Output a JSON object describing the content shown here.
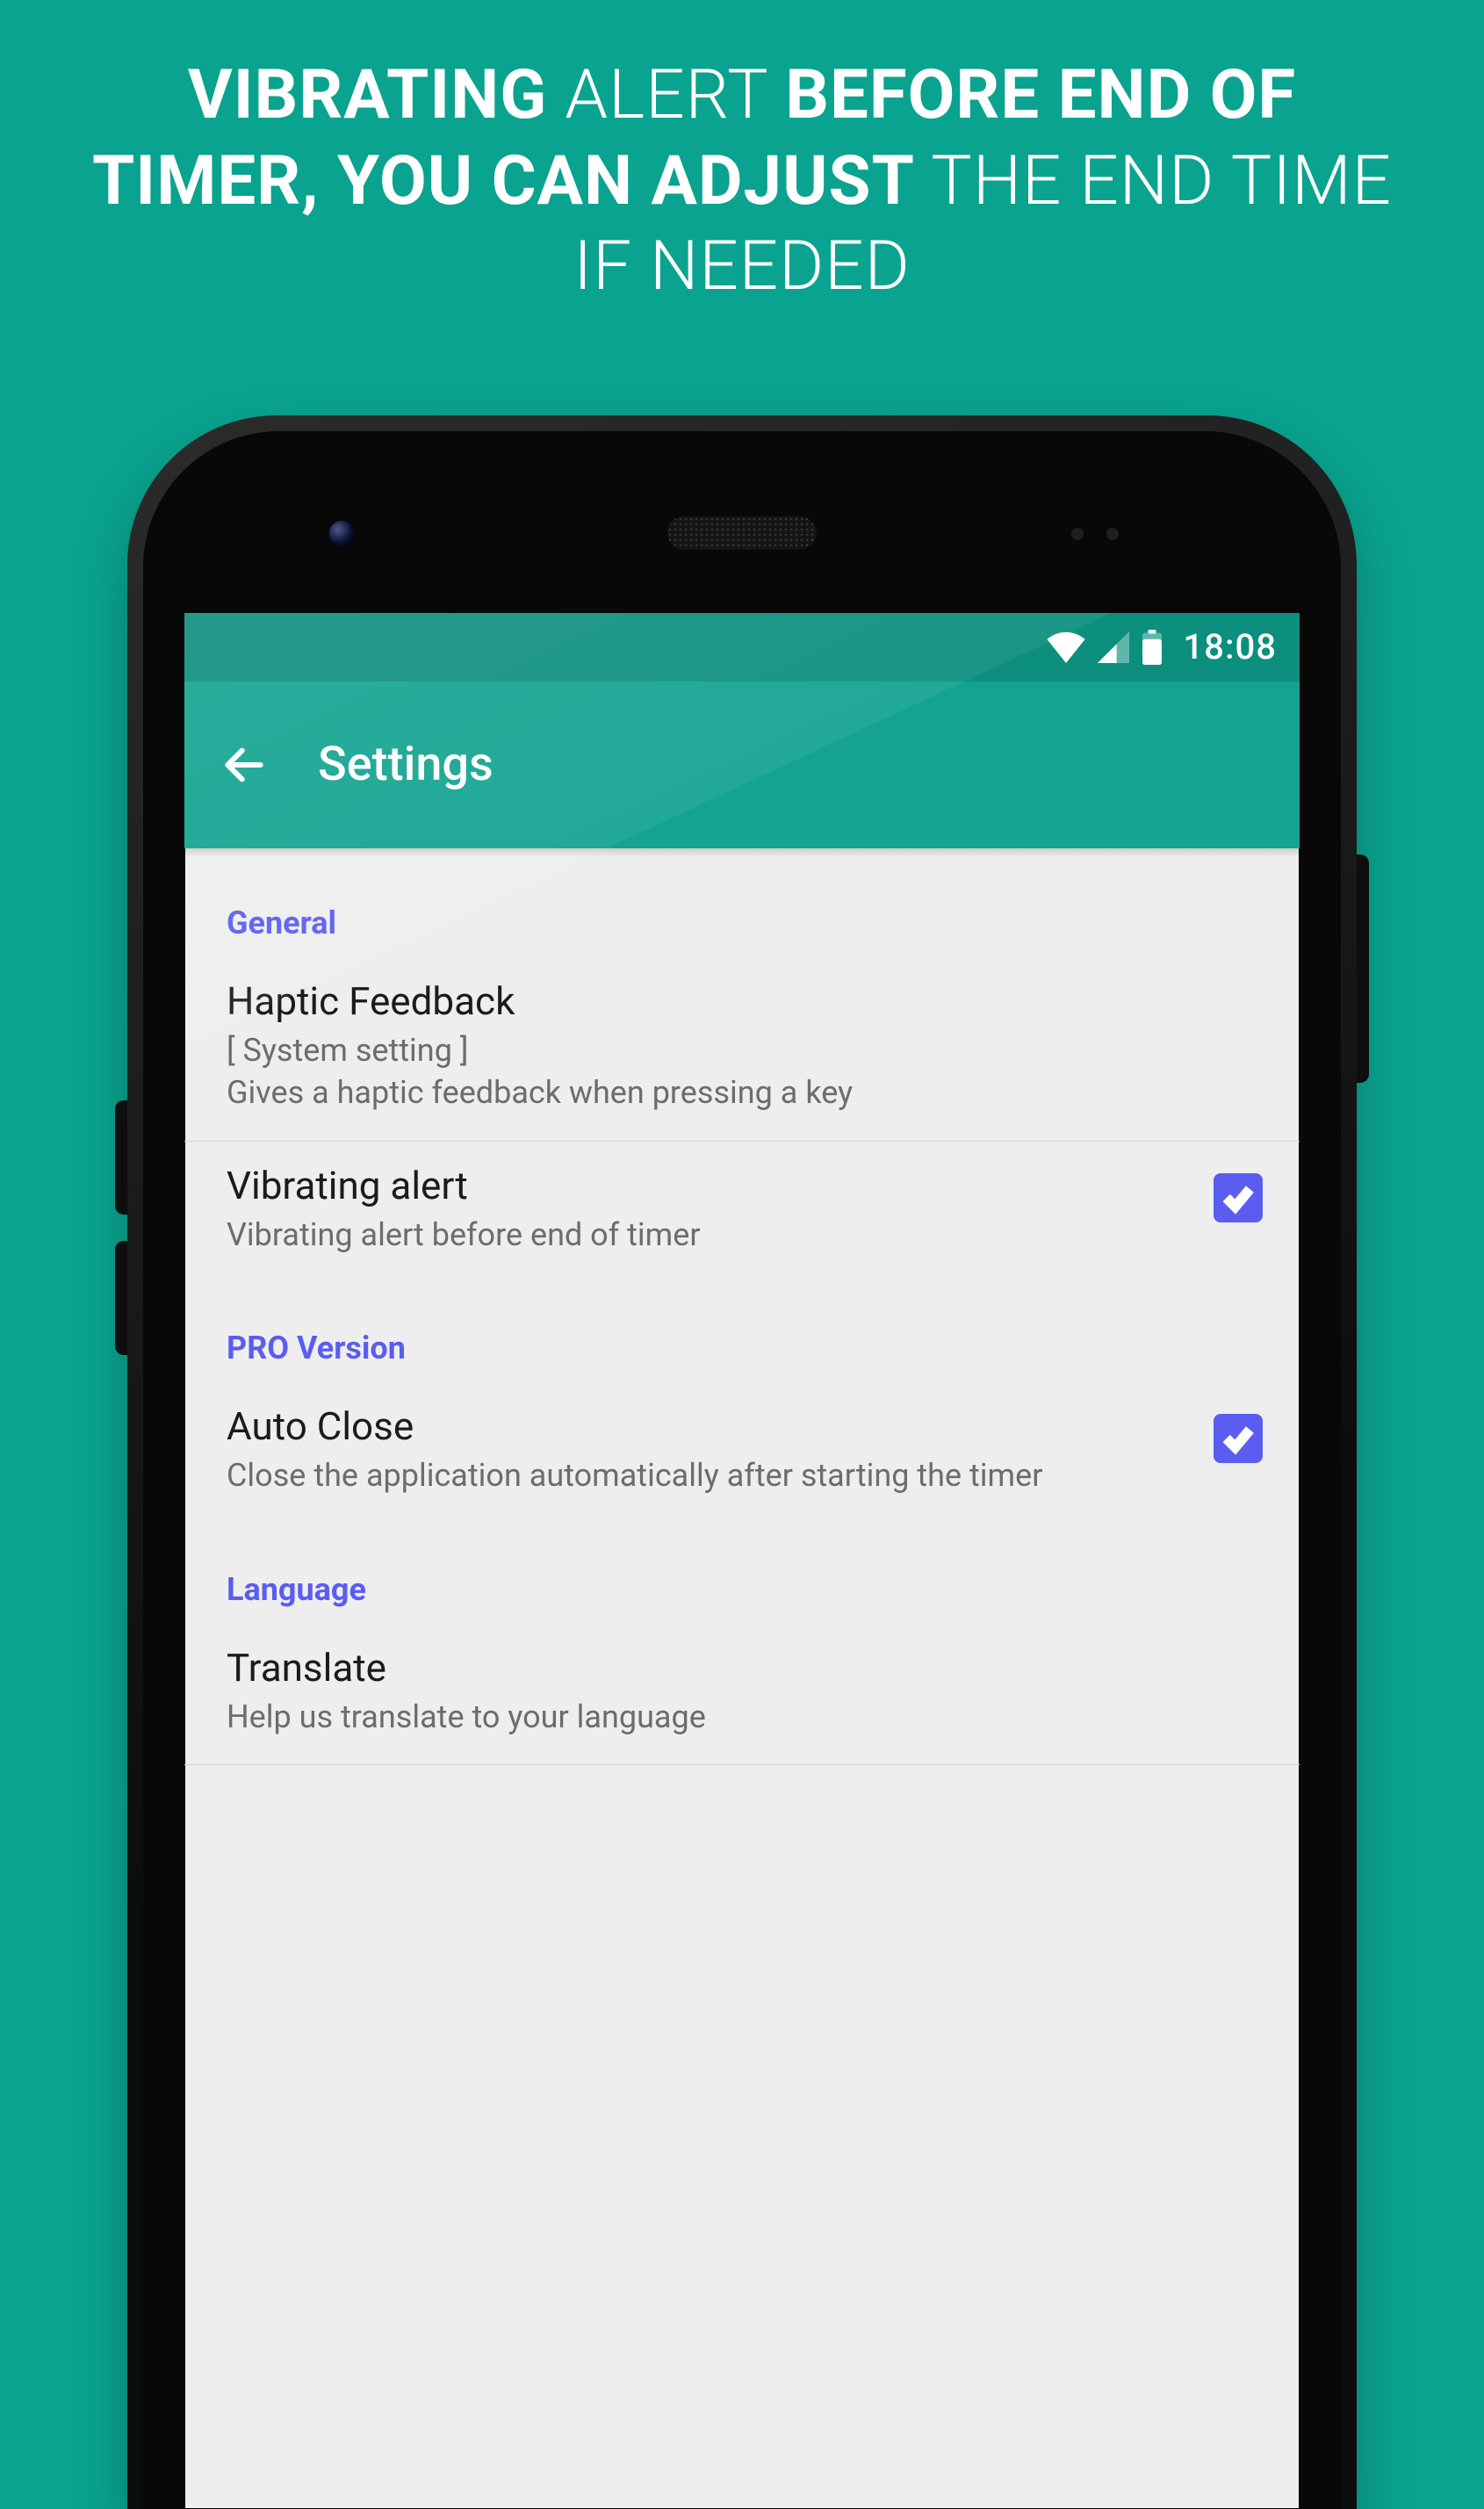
{
  "headline": {
    "p1": "VIBRATING",
    "p2": " ALERT ",
    "p3": "BEFORE END OF TIMER,",
    "p4": " YOU CAN ADJUST ",
    "p5": "THE END TIME IF NEEDED"
  },
  "statusbar": {
    "time": "18:08"
  },
  "appbar": {
    "title": "Settings"
  },
  "sections": {
    "general": {
      "label": "General",
      "haptic": {
        "title": "Haptic Feedback",
        "sub": "[ System setting ]\nGives a haptic feedback when pressing a key"
      },
      "vibrate": {
        "title": "Vibrating alert",
        "sub": "Vibrating alert before end of timer",
        "checked": true
      }
    },
    "pro": {
      "label": "PRO Version",
      "autoclose": {
        "title": "Auto Close",
        "sub": "Close the application automatically after starting the timer",
        "checked": true
      }
    },
    "language": {
      "label": "Language",
      "translate": {
        "title": "Translate",
        "sub": "Help us translate to your language"
      }
    }
  }
}
